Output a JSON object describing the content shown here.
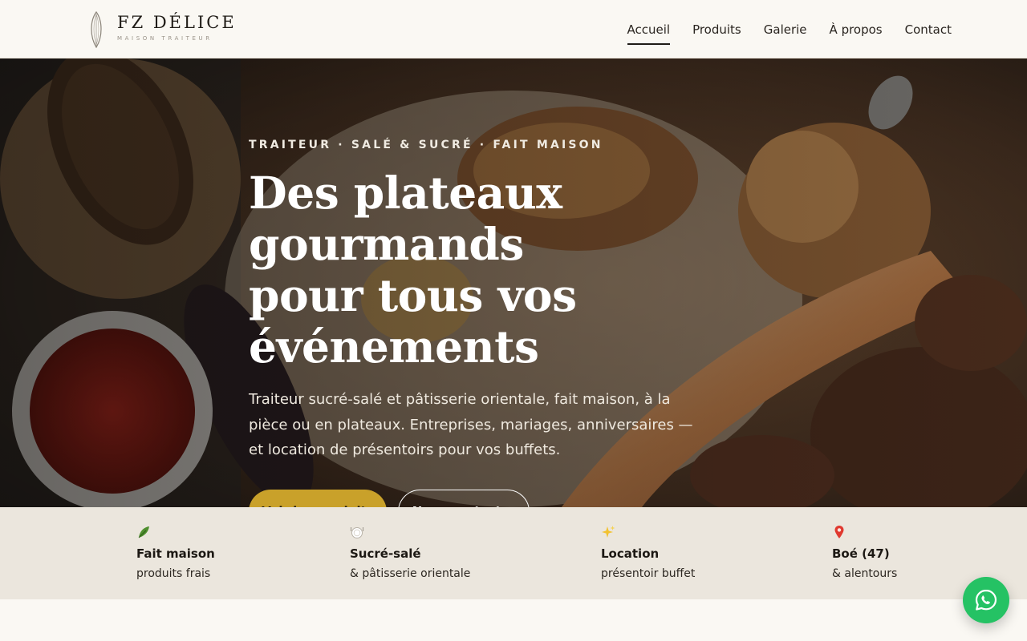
{
  "brand": {
    "name": "FZ DÉLICE",
    "tagline": "MAISON TRAITEUR"
  },
  "nav": {
    "items": [
      {
        "label": "Accueil",
        "active": true
      },
      {
        "label": "Produits",
        "active": false
      },
      {
        "label": "Galerie",
        "active": false
      },
      {
        "label": "À propos",
        "active": false
      },
      {
        "label": "Contact",
        "active": false
      }
    ]
  },
  "hero": {
    "kicker": "TRAITEUR · SALÉ & SUCRÉ · FAIT MAISON",
    "title_line1": "Des plateaux gourmands",
    "title_line2": "pour tous vos événements",
    "subtitle": "Traiteur sucré-salé et pâtisserie orientale, fait maison, à la pièce ou en plateaux. Entreprises, mariages, anniversaires — et location de présentoirs pour vos buffets.",
    "primary_cta": "Voir les produits",
    "secondary_cta": "Nous contacter"
  },
  "features": [
    {
      "icon": "herb-icon",
      "title": "Fait maison",
      "sub": "produits frais"
    },
    {
      "icon": "plate-icon",
      "title": "Sucré-salé",
      "sub": "& pâtisserie orientale"
    },
    {
      "icon": "sparkles-icon",
      "title": "Location",
      "sub": "présentoir buffet"
    },
    {
      "icon": "location-pin-icon",
      "title": "Boé (47)",
      "sub": "& alentours"
    }
  ],
  "chat": {
    "icon": "whatsapp-icon"
  },
  "colors": {
    "accent": "#c9a12a",
    "background": "#faf8f3",
    "strip": "#ebe6dd",
    "chat": "#25c264"
  }
}
